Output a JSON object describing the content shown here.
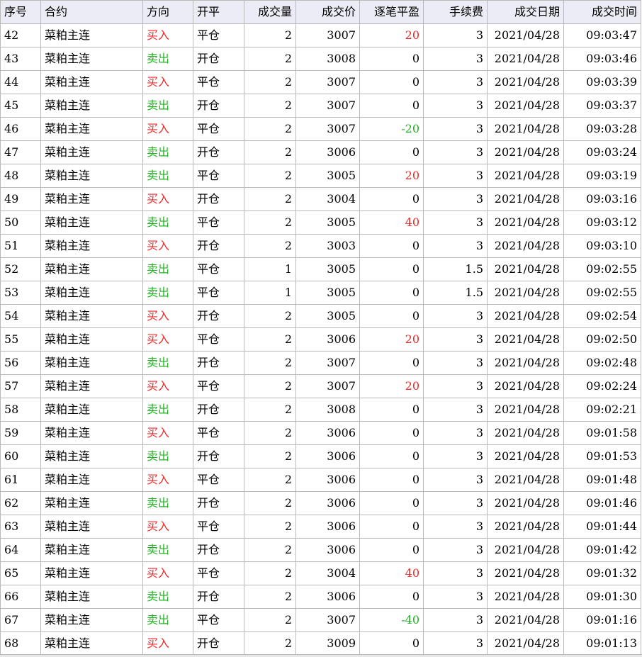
{
  "columns": [
    {
      "key": "seq",
      "label": "序号"
    },
    {
      "key": "contract",
      "label": "合约"
    },
    {
      "key": "direction",
      "label": "方向"
    },
    {
      "key": "openclose",
      "label": "开平"
    },
    {
      "key": "qty",
      "label": "成交量"
    },
    {
      "key": "price",
      "label": "成交价"
    },
    {
      "key": "pnl",
      "label": "逐笔平盈"
    },
    {
      "key": "fee",
      "label": "手续费"
    },
    {
      "key": "date",
      "label": "成交日期"
    },
    {
      "key": "time",
      "label": "成交时间"
    }
  ],
  "colors": {
    "buy": "#ee2b2b",
    "sell": "#22b422",
    "profit": "#ee2b2b",
    "loss": "#22b422",
    "header_bg": "#ececf7",
    "grid": "#b9b9b9"
  },
  "rows": [
    {
      "seq": "42",
      "contract": "菜粕主连",
      "direction": "买入",
      "openclose": "平仓",
      "qty": "2",
      "price": "3007",
      "pnl": "20",
      "fee": "3",
      "date": "2021/04/28",
      "time": "09:03:47"
    },
    {
      "seq": "43",
      "contract": "菜粕主连",
      "direction": "卖出",
      "openclose": "开仓",
      "qty": "2",
      "price": "3008",
      "pnl": "0",
      "fee": "3",
      "date": "2021/04/28",
      "time": "09:03:46"
    },
    {
      "seq": "44",
      "contract": "菜粕主连",
      "direction": "买入",
      "openclose": "平仓",
      "qty": "2",
      "price": "3007",
      "pnl": "0",
      "fee": "3",
      "date": "2021/04/28",
      "time": "09:03:39"
    },
    {
      "seq": "45",
      "contract": "菜粕主连",
      "direction": "卖出",
      "openclose": "开仓",
      "qty": "2",
      "price": "3007",
      "pnl": "0",
      "fee": "3",
      "date": "2021/04/28",
      "time": "09:03:37"
    },
    {
      "seq": "46",
      "contract": "菜粕主连",
      "direction": "买入",
      "openclose": "平仓",
      "qty": "2",
      "price": "3007",
      "pnl": "-20",
      "fee": "3",
      "date": "2021/04/28",
      "time": "09:03:28"
    },
    {
      "seq": "47",
      "contract": "菜粕主连",
      "direction": "卖出",
      "openclose": "开仓",
      "qty": "2",
      "price": "3006",
      "pnl": "0",
      "fee": "3",
      "date": "2021/04/28",
      "time": "09:03:24"
    },
    {
      "seq": "48",
      "contract": "菜粕主连",
      "direction": "卖出",
      "openclose": "平仓",
      "qty": "2",
      "price": "3005",
      "pnl": "20",
      "fee": "3",
      "date": "2021/04/28",
      "time": "09:03:19"
    },
    {
      "seq": "49",
      "contract": "菜粕主连",
      "direction": "买入",
      "openclose": "开仓",
      "qty": "2",
      "price": "3004",
      "pnl": "0",
      "fee": "3",
      "date": "2021/04/28",
      "time": "09:03:16"
    },
    {
      "seq": "50",
      "contract": "菜粕主连",
      "direction": "卖出",
      "openclose": "平仓",
      "qty": "2",
      "price": "3005",
      "pnl": "40",
      "fee": "3",
      "date": "2021/04/28",
      "time": "09:03:12"
    },
    {
      "seq": "51",
      "contract": "菜粕主连",
      "direction": "买入",
      "openclose": "开仓",
      "qty": "2",
      "price": "3003",
      "pnl": "0",
      "fee": "3",
      "date": "2021/04/28",
      "time": "09:03:10"
    },
    {
      "seq": "52",
      "contract": "菜粕主连",
      "direction": "卖出",
      "openclose": "平仓",
      "qty": "1",
      "price": "3005",
      "pnl": "0",
      "fee": "1.5",
      "date": "2021/04/28",
      "time": "09:02:55"
    },
    {
      "seq": "53",
      "contract": "菜粕主连",
      "direction": "卖出",
      "openclose": "平仓",
      "qty": "1",
      "price": "3005",
      "pnl": "0",
      "fee": "1.5",
      "date": "2021/04/28",
      "time": "09:02:55"
    },
    {
      "seq": "54",
      "contract": "菜粕主连",
      "direction": "买入",
      "openclose": "开仓",
      "qty": "2",
      "price": "3005",
      "pnl": "0",
      "fee": "3",
      "date": "2021/04/28",
      "time": "09:02:54"
    },
    {
      "seq": "55",
      "contract": "菜粕主连",
      "direction": "买入",
      "openclose": "平仓",
      "qty": "2",
      "price": "3006",
      "pnl": "20",
      "fee": "3",
      "date": "2021/04/28",
      "time": "09:02:50"
    },
    {
      "seq": "56",
      "contract": "菜粕主连",
      "direction": "卖出",
      "openclose": "开仓",
      "qty": "2",
      "price": "3007",
      "pnl": "0",
      "fee": "3",
      "date": "2021/04/28",
      "time": "09:02:48"
    },
    {
      "seq": "57",
      "contract": "菜粕主连",
      "direction": "买入",
      "openclose": "平仓",
      "qty": "2",
      "price": "3007",
      "pnl": "20",
      "fee": "3",
      "date": "2021/04/28",
      "time": "09:02:24"
    },
    {
      "seq": "58",
      "contract": "菜粕主连",
      "direction": "卖出",
      "openclose": "开仓",
      "qty": "2",
      "price": "3008",
      "pnl": "0",
      "fee": "3",
      "date": "2021/04/28",
      "time": "09:02:21"
    },
    {
      "seq": "59",
      "contract": "菜粕主连",
      "direction": "买入",
      "openclose": "平仓",
      "qty": "2",
      "price": "3006",
      "pnl": "0",
      "fee": "3",
      "date": "2021/04/28",
      "time": "09:01:58"
    },
    {
      "seq": "60",
      "contract": "菜粕主连",
      "direction": "卖出",
      "openclose": "开仓",
      "qty": "2",
      "price": "3006",
      "pnl": "0",
      "fee": "3",
      "date": "2021/04/28",
      "time": "09:01:53"
    },
    {
      "seq": "61",
      "contract": "菜粕主连",
      "direction": "买入",
      "openclose": "平仓",
      "qty": "2",
      "price": "3006",
      "pnl": "0",
      "fee": "3",
      "date": "2021/04/28",
      "time": "09:01:48"
    },
    {
      "seq": "62",
      "contract": "菜粕主连",
      "direction": "卖出",
      "openclose": "开仓",
      "qty": "2",
      "price": "3006",
      "pnl": "0",
      "fee": "3",
      "date": "2021/04/28",
      "time": "09:01:46"
    },
    {
      "seq": "63",
      "contract": "菜粕主连",
      "direction": "买入",
      "openclose": "平仓",
      "qty": "2",
      "price": "3006",
      "pnl": "0",
      "fee": "3",
      "date": "2021/04/28",
      "time": "09:01:44"
    },
    {
      "seq": "64",
      "contract": "菜粕主连",
      "direction": "卖出",
      "openclose": "开仓",
      "qty": "2",
      "price": "3006",
      "pnl": "0",
      "fee": "3",
      "date": "2021/04/28",
      "time": "09:01:42"
    },
    {
      "seq": "65",
      "contract": "菜粕主连",
      "direction": "买入",
      "openclose": "平仓",
      "qty": "2",
      "price": "3004",
      "pnl": "40",
      "fee": "3",
      "date": "2021/04/28",
      "time": "09:01:32"
    },
    {
      "seq": "66",
      "contract": "菜粕主连",
      "direction": "卖出",
      "openclose": "开仓",
      "qty": "2",
      "price": "3006",
      "pnl": "0",
      "fee": "3",
      "date": "2021/04/28",
      "time": "09:01:30"
    },
    {
      "seq": "67",
      "contract": "菜粕主连",
      "direction": "卖出",
      "openclose": "平仓",
      "qty": "2",
      "price": "3007",
      "pnl": "-40",
      "fee": "3",
      "date": "2021/04/28",
      "time": "09:01:16"
    },
    {
      "seq": "68",
      "contract": "菜粕主连",
      "direction": "买入",
      "openclose": "开仓",
      "qty": "2",
      "price": "3009",
      "pnl": "0",
      "fee": "3",
      "date": "2021/04/28",
      "time": "09:01:13"
    }
  ]
}
